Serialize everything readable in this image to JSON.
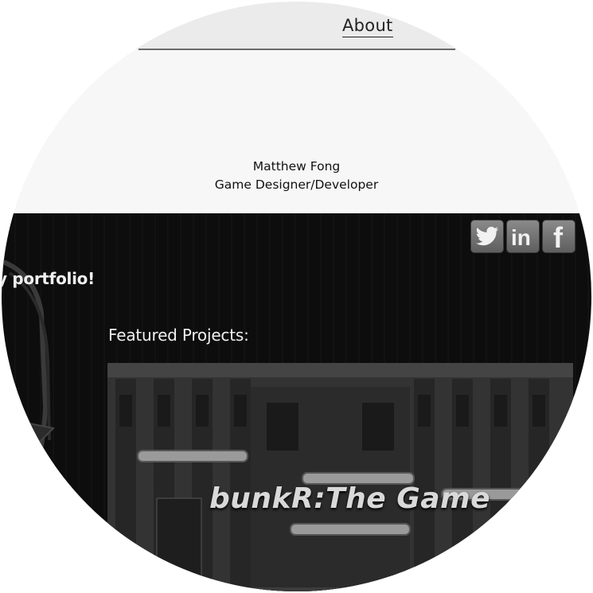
{
  "nav": {
    "about_label": "About"
  },
  "bio": {
    "name": "Matthew Fong",
    "role": "Game Designer/Developer"
  },
  "social": [
    {
      "icon": "twitter-icon",
      "label": "Twitter"
    },
    {
      "icon": "linkedin-icon",
      "label": "in"
    },
    {
      "icon": "facebook-icon",
      "label": "f"
    }
  ],
  "welcome": {
    "text": "y portfolio!"
  },
  "featured": {
    "heading": "Featured Projects:",
    "projects": [
      {
        "title": "bunkR:The Game"
      }
    ]
  },
  "colors": {
    "page_bg": "#f7f7f7",
    "dark_bg": "#0d0d0d",
    "icon_bg": "#707070"
  }
}
